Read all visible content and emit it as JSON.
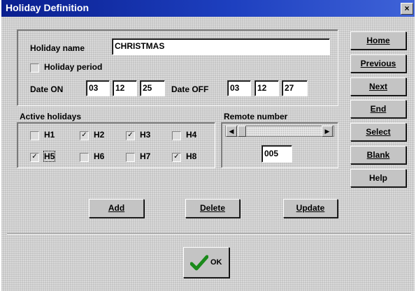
{
  "window": {
    "title": "Holiday Definition",
    "close_glyph": "×"
  },
  "form": {
    "holiday_name_label": "Holiday name",
    "holiday_name_value": "CHRISTMAS",
    "holiday_period_label": "Holiday period",
    "holiday_period_checked": false,
    "date_on_label": "Date ON",
    "date_on": [
      "03",
      "12",
      "25"
    ],
    "date_off_label": "Date OFF",
    "date_off": [
      "03",
      "12",
      "27"
    ]
  },
  "active_holidays": {
    "label": "Active holidays",
    "items": [
      {
        "label": "H1",
        "checked": false
      },
      {
        "label": "H2",
        "checked": true
      },
      {
        "label": "H3",
        "checked": true
      },
      {
        "label": "H4",
        "checked": false
      },
      {
        "label": "H5",
        "checked": true
      },
      {
        "label": "H6",
        "checked": false
      },
      {
        "label": "H7",
        "checked": false
      },
      {
        "label": "H8",
        "checked": true
      }
    ]
  },
  "remote": {
    "label": "Remote number",
    "value": "005",
    "left_arrow": "◀",
    "right_arrow": "▶"
  },
  "side_buttons": [
    "Home",
    "Previous",
    "Next",
    "End",
    "Select",
    "Blank",
    "Help"
  ],
  "action_buttons": [
    "Add",
    "Delete",
    "Update"
  ],
  "ok": {
    "label": "OK",
    "check_color": "#1a8a1a"
  }
}
